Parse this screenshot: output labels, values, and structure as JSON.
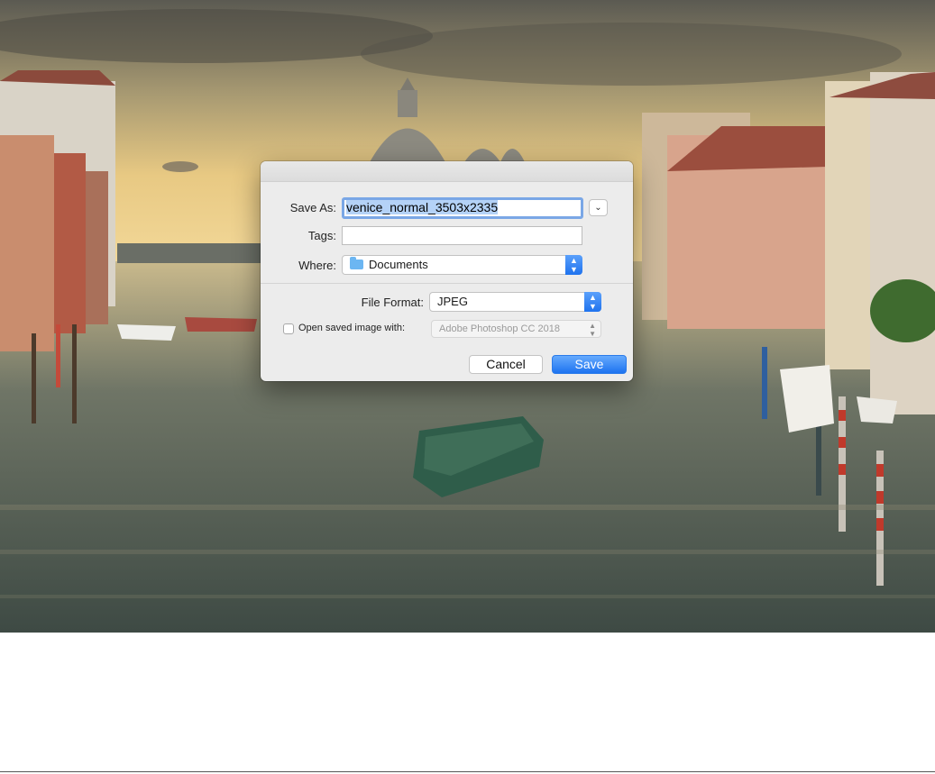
{
  "dialog": {
    "save_as_label": "Save As:",
    "save_as_value": "venice_normal_3503x2335",
    "tags_label": "Tags:",
    "tags_value": "",
    "where_label": "Where:",
    "where_value": "Documents",
    "file_format_label": "File Format:",
    "file_format_value": "JPEG",
    "open_with_label": "Open saved image with:",
    "open_with_checked": false,
    "open_with_app": "Adobe Photoshop CC 2018",
    "cancel_label": "Cancel",
    "save_label": "Save"
  },
  "icons": {
    "expand": "chevron-down-icon",
    "folder": "folder-icon",
    "popup_arrows": "up-down-chevron-icon"
  },
  "colors": {
    "accent": "#1f73ee",
    "selection": "#b4d2f7",
    "focus_ring": "#7aa7e6",
    "dialog_bg": "#ececec"
  }
}
